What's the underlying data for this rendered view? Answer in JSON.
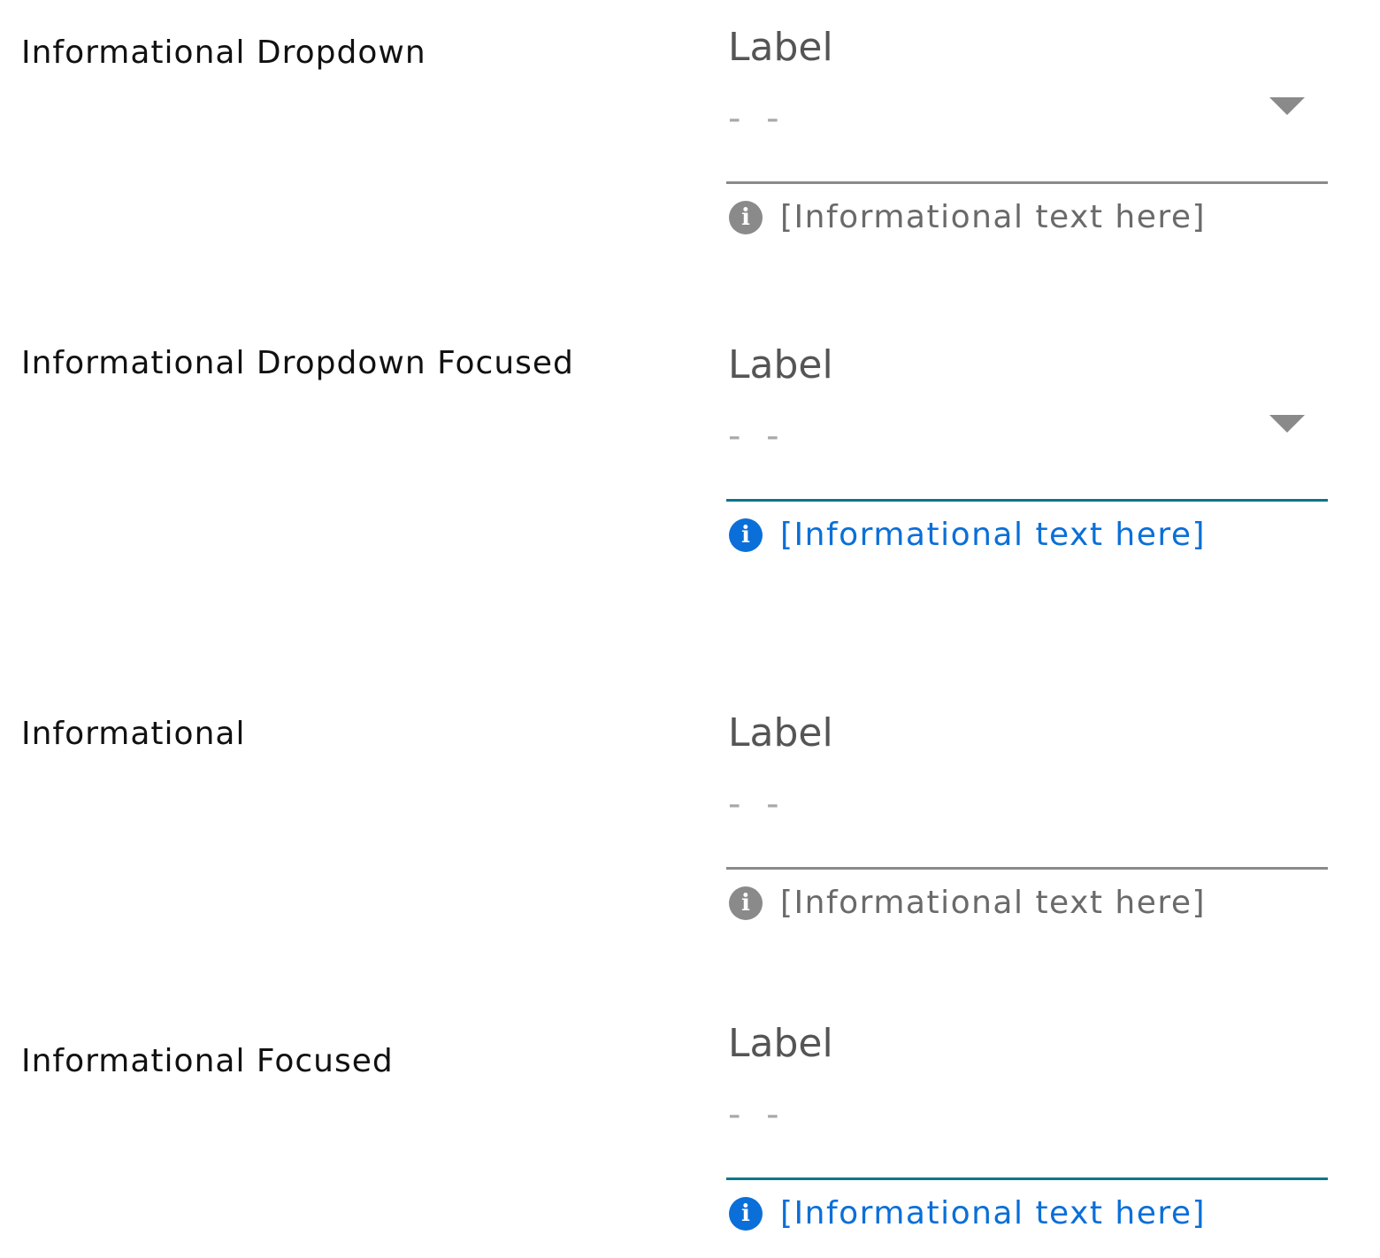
{
  "colors": {
    "title_text": "#111111",
    "label_text": "#555555",
    "placeholder_text": "#a8a8a8",
    "underline_default": "#8a8a8a",
    "underline_focused": "#00788a",
    "info_default": "#8a8a8a",
    "info_focused": "#0a6fd8"
  },
  "rows": [
    {
      "title": "Informational Dropdown",
      "field": {
        "label": "Label",
        "value": "- -",
        "has_dropdown": true,
        "dropdown_icon": "triangle-down-icon",
        "focused": false,
        "helper_icon": "info-icon",
        "helper_text": "[Informational text here]"
      }
    },
    {
      "title": "Informational Dropdown Focused",
      "field": {
        "label": "Label",
        "value": "- -",
        "has_dropdown": true,
        "dropdown_icon": "triangle-down-icon",
        "focused": true,
        "helper_icon": "info-icon",
        "helper_text": "[Informational text here]"
      }
    },
    {
      "title": "Informational",
      "field": {
        "label": "Label",
        "value": "- -",
        "has_dropdown": false,
        "focused": false,
        "helper_icon": "info-icon",
        "helper_text": "[Informational text here]"
      }
    },
    {
      "title": "Informational Focused",
      "field": {
        "label": "Label",
        "value": "- -",
        "has_dropdown": false,
        "focused": true,
        "helper_icon": "info-icon",
        "helper_text": "[Informational text here]"
      }
    }
  ]
}
